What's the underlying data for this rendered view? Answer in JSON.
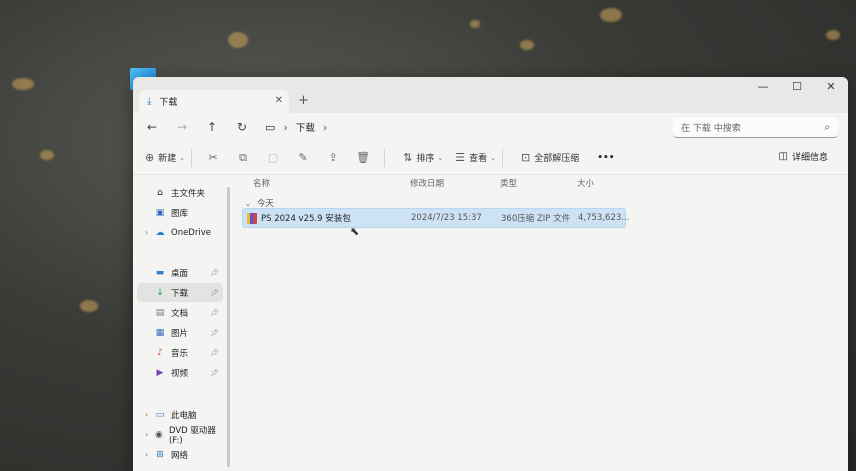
{
  "window": {
    "tab_title": "下载",
    "tab_icon": "download-icon",
    "new_tab": "+",
    "close_tab": "✕",
    "controls": {
      "minimize": "—",
      "maximize": "☐",
      "close": "✕"
    }
  },
  "nav": {
    "back": "←",
    "forward": "→",
    "up": "↑",
    "refresh": "↻",
    "breadcrumb": [
      "下载"
    ],
    "chevron": "›",
    "search_placeholder": "在 下载 中搜索"
  },
  "toolbar": {
    "new_label": "新建",
    "sort_label": "排序",
    "view_label": "查看",
    "extract_label": "全部解压缩",
    "more": "•••",
    "details_label": "详细信息"
  },
  "sidebar": {
    "items": [
      {
        "label": "主文件夹",
        "icon": "home-icon",
        "glyph": "⌂"
      },
      {
        "label": "图库",
        "icon": "gallery-icon",
        "glyph": "▣"
      },
      {
        "label": "OneDrive",
        "icon": "onedrive-cloud-icon",
        "glyph": "☁"
      },
      {
        "label": "桌面",
        "icon": "desktop-icon",
        "glyph": "▬",
        "pinned": true
      },
      {
        "label": "下载",
        "icon": "download-icon",
        "glyph": "↓",
        "pinned": true,
        "selected": true
      },
      {
        "label": "文档",
        "icon": "documents-icon",
        "glyph": "▤",
        "pinned": true
      },
      {
        "label": "图片",
        "icon": "pictures-icon",
        "glyph": "▦",
        "pinned": true
      },
      {
        "label": "音乐",
        "icon": "music-icon",
        "glyph": "♪",
        "pinned": true
      },
      {
        "label": "视频",
        "icon": "videos-icon",
        "glyph": "▶",
        "pinned": true
      },
      {
        "label": "此电脑",
        "icon": "this-pc-icon",
        "glyph": "▭"
      },
      {
        "label": "DVD 驱动器 (F:)",
        "icon": "dvd-drive-icon",
        "glyph": "◉"
      },
      {
        "label": "网络",
        "icon": "network-icon",
        "glyph": "⊞"
      }
    ]
  },
  "columns": {
    "name": "名称",
    "modified": "修改日期",
    "type": "类型",
    "size": "大小"
  },
  "group": {
    "label": "今天"
  },
  "files": [
    {
      "name": "PS 2024 v25.9 安装包",
      "modified": "2024/7/23 15:37",
      "type": "360压缩 ZIP 文件",
      "size": "4,753,623..."
    }
  ],
  "colors": {
    "selection": "#cde3f5",
    "accent": "#1d7fd6"
  }
}
